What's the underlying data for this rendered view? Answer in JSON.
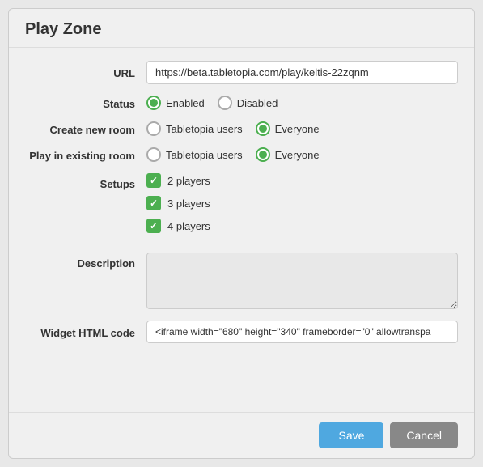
{
  "window": {
    "title": "Play Zone"
  },
  "form": {
    "url_label": "URL",
    "url_value": "https://beta.tabletopia.com/play/keltis-22zqnm",
    "url_placeholder": "https://beta.tabletopia.com/play/keltis-22zqnm",
    "status_label": "Status",
    "status_enabled": "Enabled",
    "status_disabled": "Disabled",
    "create_new_room_label": "Create new room",
    "play_existing_room_label": "Play in existing room",
    "create_option1": "Tabletopia users",
    "create_option2": "Everyone",
    "play_option1": "Tabletopia users",
    "play_option2": "Everyone",
    "setups_label": "Setups",
    "setup1": "2 players",
    "setup2": "3 players",
    "setup3": "4 players",
    "description_label": "Description",
    "description_value": "",
    "description_placeholder": "",
    "widget_label": "Widget HTML code",
    "widget_value": "<iframe width=\"680\" height=\"340\" frameborder=\"0\" allowtranspa",
    "save_button": "Save",
    "cancel_button": "Cancel"
  }
}
